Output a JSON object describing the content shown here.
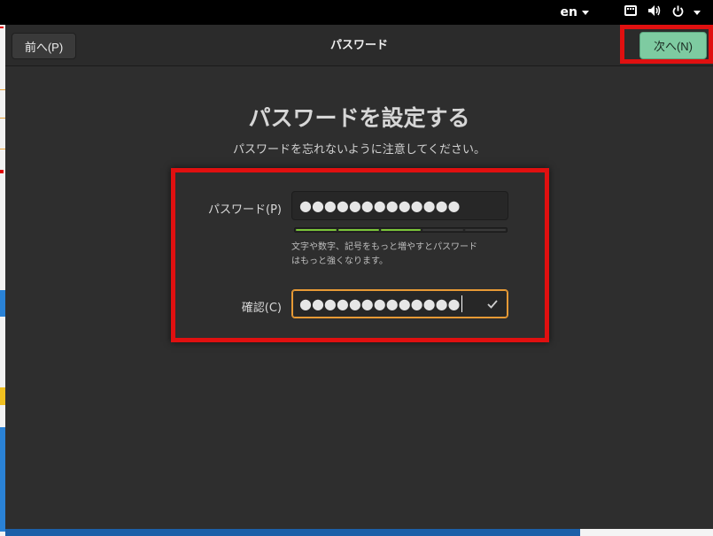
{
  "top_panel": {
    "language": "en",
    "icons": [
      "keyboard-icon",
      "volume-icon",
      "power-icon"
    ]
  },
  "header": {
    "title": "パスワード",
    "back_label": "前へ(P)",
    "next_label": "次へ(N)"
  },
  "page": {
    "heading": "パスワードを設定する",
    "subtitle": "パスワードを忘れないように注意してください。"
  },
  "form": {
    "password_label": "パスワード(P)",
    "password_value": "●●●●●●●●●●●●●",
    "confirm_label": "確認(C)",
    "confirm_value": "●●●●●●●●●●●●●",
    "strength_level": 0.6,
    "strength_hint_line1": "文字や数字、記号をもっと増やすとパスワード",
    "strength_hint_line2": "はもっと強くなります。"
  },
  "colors": {
    "accent_next": "#7ecba1",
    "strength_fill": "#7bc639",
    "strength_empty": "#3a3a3a",
    "focus_border": "#e79a35",
    "highlight_red": "#e01010"
  }
}
